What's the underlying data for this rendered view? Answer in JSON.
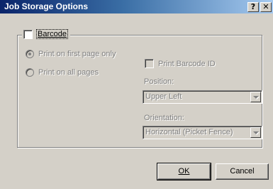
{
  "window": {
    "title": "Job Storage Options",
    "help_glyph": "?",
    "close_glyph": "✕"
  },
  "barcode_group": {
    "checkbox_label": "Barcode",
    "radios": [
      {
        "label": "Print on first page only",
        "selected": true
      },
      {
        "label": "Print on all pages",
        "selected": false
      }
    ],
    "print_barcode_id_label": "Print Barcode ID",
    "position_label": "Position:",
    "position_value": "Upper Left",
    "orientation_label": "Orientation:",
    "orientation_value": "Horizontal (Picket Fence)"
  },
  "buttons": {
    "ok_label": "OK",
    "cancel_label": "Cancel"
  },
  "colors": {
    "titlebar": "#0a246a",
    "face": "#d4d0c8",
    "disabled_text": "#808080"
  }
}
